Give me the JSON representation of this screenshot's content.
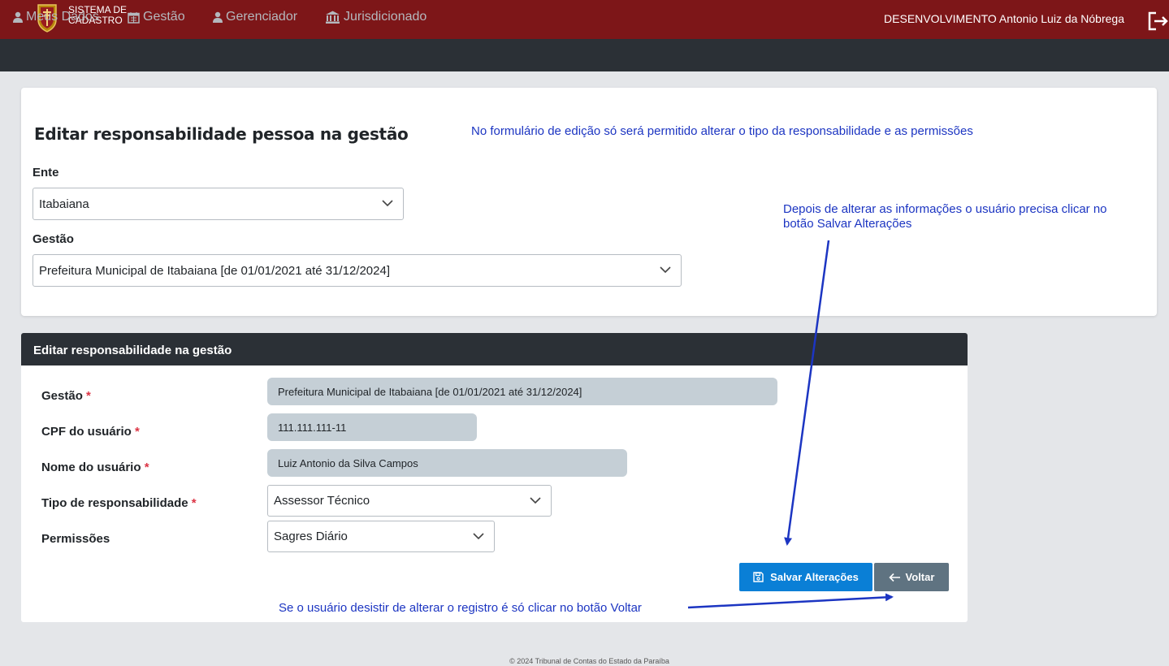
{
  "header": {
    "brand_line1": "SISTEMA DE",
    "brand_line2": "CADASTRO",
    "user_label": "DESENVOLVIMENTO Antonio Luiz da Nóbrega",
    "logo_icon": "tce-crest-icon",
    "logout_icon": "logout-icon",
    "bar_color": "#7d1618"
  },
  "nav": {
    "items": [
      {
        "label": "Meus Dados",
        "icon": "user-icon"
      },
      {
        "label": "Gestão",
        "icon": "calendar-icon"
      },
      {
        "label": "Gerenciador",
        "icon": "user-icon"
      },
      {
        "label": "Jurisdicionado",
        "icon": "bank-icon"
      }
    ]
  },
  "filter": {
    "title": "Editar responsabilidade pessoa na gestão",
    "ente_label": "Ente",
    "ente_value": "Itabaiana",
    "gestao_label": "Gestão",
    "gestao_value": "Prefeitura Municipal de Itabaiana [de 01/01/2021 até 31/12/2024]"
  },
  "form": {
    "title": "Editar responsabilidade na gestão",
    "required_mark": "*",
    "fields": [
      {
        "label": "Gestão",
        "value": "Prefeitura Municipal de Itabaiana [de 01/01/2021 até 31/12/2024]"
      },
      {
        "label": "CPF do usuário",
        "value": "111.111.111-11"
      },
      {
        "label": "Nome do usuário",
        "value": "Luiz Antonio da Silva Campos"
      },
      {
        "label": "Tipo de responsabilidade",
        "value": "Assessor Técnico"
      },
      {
        "label": "Permissões",
        "value": "Sagres Diário"
      }
    ],
    "save_label": "Salvar Alterações",
    "back_label": "Voltar",
    "save_color": "#0a7fd6",
    "back_color": "#5f7381"
  },
  "annotations": {
    "note_top": "No formulário de edição só será permitido alterar o tipo da responsabilidade e as permissões",
    "note_save_line1": "Depois de alterar as informações o usuário precisa clicar no",
    "note_save_line2": "botão Salvar Alterações",
    "note_back": "Se o usuário desistir de alterar o registro é só clicar no botão Voltar",
    "color": "#1c35c2"
  },
  "footer": {
    "text": "© 2024 Tribunal de Contas do Estado da Paraíba"
  }
}
